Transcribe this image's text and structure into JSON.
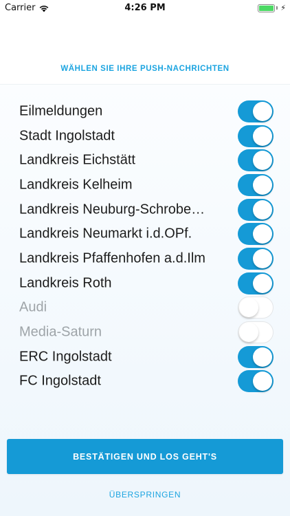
{
  "status_bar": {
    "carrier": "Carrier",
    "time": "4:26 PM",
    "wifi_icon": "wifi-icon",
    "battery_level": 1.0,
    "charging_icon": "bolt-icon"
  },
  "header": {
    "title": "WÄHLEN SIE IHRE PUSH-NACHRICHTEN"
  },
  "toggles": [
    {
      "label": "Eilmeldungen",
      "on": true
    },
    {
      "label": "Stadt Ingolstadt",
      "on": true
    },
    {
      "label": "Landkreis Eichstätt",
      "on": true
    },
    {
      "label": "Landkreis Kelheim",
      "on": true
    },
    {
      "label": "Landkreis Neuburg-Schrobe…",
      "on": true
    },
    {
      "label": "Landkreis Neumarkt i.d.OPf.",
      "on": true
    },
    {
      "label": "Landkreis Pfaffenhofen a.d.Ilm",
      "on": true
    },
    {
      "label": "Landkreis Roth",
      "on": true
    },
    {
      "label": "Audi",
      "on": false
    },
    {
      "label": "Media-Saturn",
      "on": false
    },
    {
      "label": "ERC Ingolstadt",
      "on": true
    },
    {
      "label": "FC Ingolstadt",
      "on": true
    }
  ],
  "actions": {
    "confirm_label": "BESTÄTIGEN UND LOS GEHT'S",
    "skip_label": "ÜBERSPRINGEN"
  },
  "colors": {
    "accent": "#159ad6",
    "header_text": "#1ba4e0",
    "disabled_text": "#9ea4a8"
  }
}
